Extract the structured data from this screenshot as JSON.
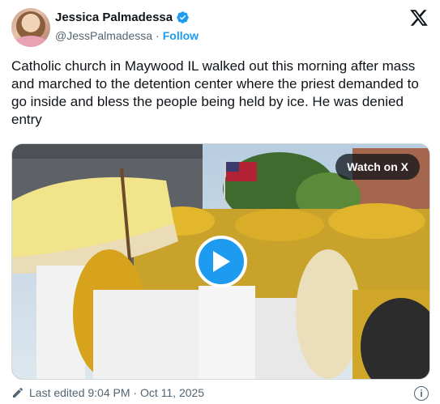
{
  "author": {
    "name": "Jessica Palmadessa",
    "handle": "@JessPalmadessa",
    "separator": "·",
    "follow_label": "Follow"
  },
  "tweet": {
    "text": "Catholic church in Maywood IL walked out this morning after mass and marched to the detention center where the priest demanded to go inside and bless the people being held by ice. He was denied entry"
  },
  "media": {
    "watch_label": "Watch on X"
  },
  "footer": {
    "edited_text": "Last edited 9:04 PM · Oct 11, 2025"
  },
  "icons": {
    "verified": "verified-badge-icon",
    "brand": "x-logo-icon",
    "play": "play-icon",
    "edit": "pencil-icon",
    "info": "info-icon"
  },
  "colors": {
    "accent": "#1d9bf0",
    "text": "#0f1419",
    "secondary": "#536471"
  }
}
